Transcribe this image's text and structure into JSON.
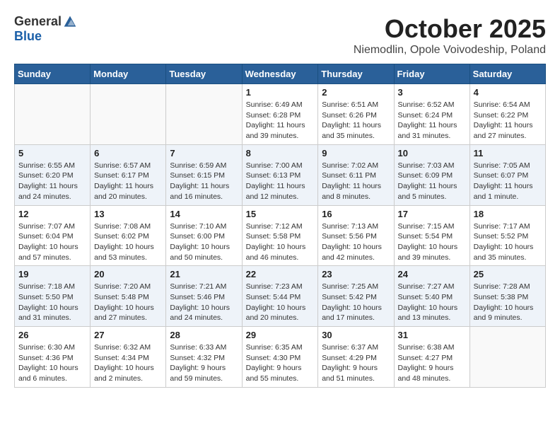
{
  "header": {
    "logo_general": "General",
    "logo_blue": "Blue",
    "month": "October 2025",
    "location": "Niemodlin, Opole Voivodeship, Poland"
  },
  "weekdays": [
    "Sunday",
    "Monday",
    "Tuesday",
    "Wednesday",
    "Thursday",
    "Friday",
    "Saturday"
  ],
  "weeks": [
    [
      {
        "day": "",
        "info": ""
      },
      {
        "day": "",
        "info": ""
      },
      {
        "day": "",
        "info": ""
      },
      {
        "day": "1",
        "info": "Sunrise: 6:49 AM\nSunset: 6:28 PM\nDaylight: 11 hours\nand 39 minutes."
      },
      {
        "day": "2",
        "info": "Sunrise: 6:51 AM\nSunset: 6:26 PM\nDaylight: 11 hours\nand 35 minutes."
      },
      {
        "day": "3",
        "info": "Sunrise: 6:52 AM\nSunset: 6:24 PM\nDaylight: 11 hours\nand 31 minutes."
      },
      {
        "day": "4",
        "info": "Sunrise: 6:54 AM\nSunset: 6:22 PM\nDaylight: 11 hours\nand 27 minutes."
      }
    ],
    [
      {
        "day": "5",
        "info": "Sunrise: 6:55 AM\nSunset: 6:20 PM\nDaylight: 11 hours\nand 24 minutes."
      },
      {
        "day": "6",
        "info": "Sunrise: 6:57 AM\nSunset: 6:17 PM\nDaylight: 11 hours\nand 20 minutes."
      },
      {
        "day": "7",
        "info": "Sunrise: 6:59 AM\nSunset: 6:15 PM\nDaylight: 11 hours\nand 16 minutes."
      },
      {
        "day": "8",
        "info": "Sunrise: 7:00 AM\nSunset: 6:13 PM\nDaylight: 11 hours\nand 12 minutes."
      },
      {
        "day": "9",
        "info": "Sunrise: 7:02 AM\nSunset: 6:11 PM\nDaylight: 11 hours\nand 8 minutes."
      },
      {
        "day": "10",
        "info": "Sunrise: 7:03 AM\nSunset: 6:09 PM\nDaylight: 11 hours\nand 5 minutes."
      },
      {
        "day": "11",
        "info": "Sunrise: 7:05 AM\nSunset: 6:07 PM\nDaylight: 11 hours\nand 1 minute."
      }
    ],
    [
      {
        "day": "12",
        "info": "Sunrise: 7:07 AM\nSunset: 6:04 PM\nDaylight: 10 hours\nand 57 minutes."
      },
      {
        "day": "13",
        "info": "Sunrise: 7:08 AM\nSunset: 6:02 PM\nDaylight: 10 hours\nand 53 minutes."
      },
      {
        "day": "14",
        "info": "Sunrise: 7:10 AM\nSunset: 6:00 PM\nDaylight: 10 hours\nand 50 minutes."
      },
      {
        "day": "15",
        "info": "Sunrise: 7:12 AM\nSunset: 5:58 PM\nDaylight: 10 hours\nand 46 minutes."
      },
      {
        "day": "16",
        "info": "Sunrise: 7:13 AM\nSunset: 5:56 PM\nDaylight: 10 hours\nand 42 minutes."
      },
      {
        "day": "17",
        "info": "Sunrise: 7:15 AM\nSunset: 5:54 PM\nDaylight: 10 hours\nand 39 minutes."
      },
      {
        "day": "18",
        "info": "Sunrise: 7:17 AM\nSunset: 5:52 PM\nDaylight: 10 hours\nand 35 minutes."
      }
    ],
    [
      {
        "day": "19",
        "info": "Sunrise: 7:18 AM\nSunset: 5:50 PM\nDaylight: 10 hours\nand 31 minutes."
      },
      {
        "day": "20",
        "info": "Sunrise: 7:20 AM\nSunset: 5:48 PM\nDaylight: 10 hours\nand 27 minutes."
      },
      {
        "day": "21",
        "info": "Sunrise: 7:21 AM\nSunset: 5:46 PM\nDaylight: 10 hours\nand 24 minutes."
      },
      {
        "day": "22",
        "info": "Sunrise: 7:23 AM\nSunset: 5:44 PM\nDaylight: 10 hours\nand 20 minutes."
      },
      {
        "day": "23",
        "info": "Sunrise: 7:25 AM\nSunset: 5:42 PM\nDaylight: 10 hours\nand 17 minutes."
      },
      {
        "day": "24",
        "info": "Sunrise: 7:27 AM\nSunset: 5:40 PM\nDaylight: 10 hours\nand 13 minutes."
      },
      {
        "day": "25",
        "info": "Sunrise: 7:28 AM\nSunset: 5:38 PM\nDaylight: 10 hours\nand 9 minutes."
      }
    ],
    [
      {
        "day": "26",
        "info": "Sunrise: 6:30 AM\nSunset: 4:36 PM\nDaylight: 10 hours\nand 6 minutes."
      },
      {
        "day": "27",
        "info": "Sunrise: 6:32 AM\nSunset: 4:34 PM\nDaylight: 10 hours\nand 2 minutes."
      },
      {
        "day": "28",
        "info": "Sunrise: 6:33 AM\nSunset: 4:32 PM\nDaylight: 9 hours\nand 59 minutes."
      },
      {
        "day": "29",
        "info": "Sunrise: 6:35 AM\nSunset: 4:30 PM\nDaylight: 9 hours\nand 55 minutes."
      },
      {
        "day": "30",
        "info": "Sunrise: 6:37 AM\nSunset: 4:29 PM\nDaylight: 9 hours\nand 51 minutes."
      },
      {
        "day": "31",
        "info": "Sunrise: 6:38 AM\nSunset: 4:27 PM\nDaylight: 9 hours\nand 48 minutes."
      },
      {
        "day": "",
        "info": ""
      }
    ]
  ]
}
